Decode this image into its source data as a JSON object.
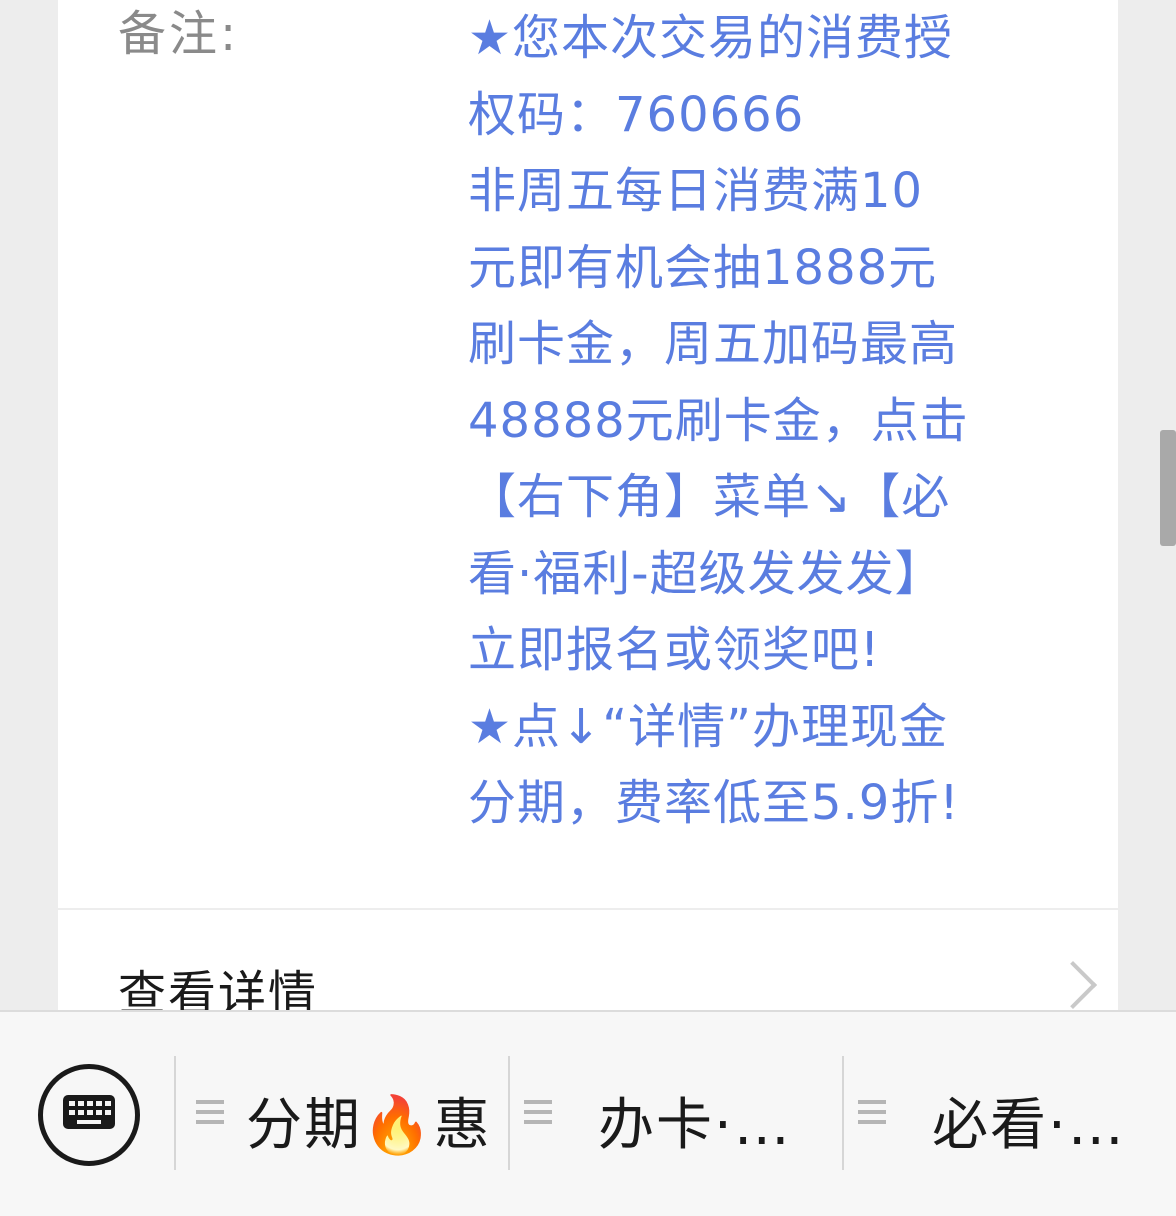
{
  "remark": {
    "label": "备注:",
    "lines": [
      "★您本次交易的消费授",
      "权码：760666",
      "非周五每日消费满10",
      "元即有机会抽1888元",
      "刷卡金，周五加码最高",
      "48888元刷卡金，点击",
      "【右下角】菜单↘【必",
      "看·福利-超级发发发】",
      "立即报名或领奖吧!",
      "★点↓“详情”办理现金",
      "分期，费率低至5.9折!"
    ]
  },
  "details": {
    "label": "查看详情"
  },
  "menu": {
    "keyboard_icon": "keyboard-icon",
    "items": [
      {
        "label": "分期🔥惠",
        "icon": "menu-lines-icon"
      },
      {
        "label": "办卡·…",
        "icon": "menu-lines-icon"
      },
      {
        "label": "必看·…",
        "icon": "menu-lines-icon"
      }
    ]
  },
  "colors": {
    "accent_text": "#5a7de0",
    "label_text": "#8a8a8a",
    "background": "#ededed"
  }
}
